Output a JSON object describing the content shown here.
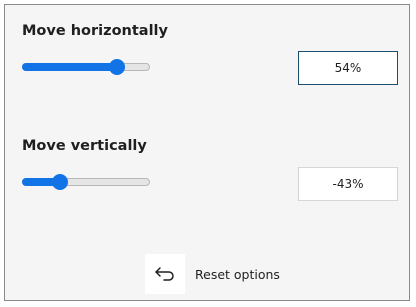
{
  "horizontal": {
    "label": "Move horizontally",
    "slider_fraction": 0.74,
    "value_text": "54%"
  },
  "vertical": {
    "label": "Move vertically",
    "slider_fraction": 0.3,
    "value_text": "-43%"
  },
  "reset": {
    "label": "Reset options",
    "icon": "undo-arrow-icon"
  },
  "colors": {
    "accent": "#1273e6",
    "focus_border": "#1b4f6b",
    "panel_bg": "#f5f5f5"
  }
}
